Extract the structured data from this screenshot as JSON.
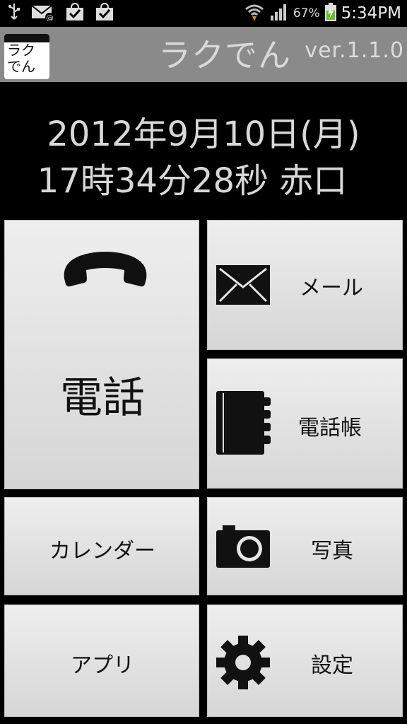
{
  "status_bar": {
    "battery_percent": "67%",
    "time": "5:34PM",
    "icons": [
      "usb-icon",
      "mail-notification-icon",
      "check-bag-icon",
      "check-bag-icon",
      "wifi-icon",
      "signal-icon",
      "battery-charging-icon"
    ]
  },
  "title_bar": {
    "icon_text_line1": "ラク",
    "icon_text_line2": "でん",
    "app_name": "ラクでん",
    "version": "ver.1.1.0"
  },
  "clock": {
    "date": "2012年9月10日(月)",
    "time": "17時34分28秒 赤口"
  },
  "tiles": {
    "phone": {
      "label": "電話",
      "icon": "phone-handset-icon"
    },
    "mail": {
      "label": "メール",
      "icon": "envelope-icon"
    },
    "phonebook": {
      "label": "電話帳",
      "icon": "address-book-icon"
    },
    "calendar": {
      "label": "カレンダー"
    },
    "photo": {
      "label": "写真",
      "icon": "camera-icon"
    },
    "apps": {
      "label": "アプリ"
    },
    "settings": {
      "label": "設定",
      "icon": "gear-icon"
    }
  }
}
